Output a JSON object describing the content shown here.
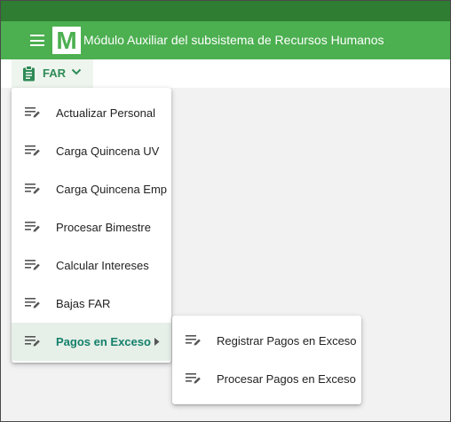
{
  "header": {
    "app_title": "Módulo Auxiliar del subsistema de Recursos Humanos",
    "logo_letter": "M",
    "menu_icon": "hamburger-icon",
    "bar_color": "#4caf50",
    "top_strip_color": "#2e7d32"
  },
  "far_menu": {
    "label": "FAR",
    "icon": "clipboard-icon",
    "chevron": "chevron-down-icon"
  },
  "dropdown": {
    "items": [
      {
        "label": "Actualizar Personal",
        "icon": "edit-list-icon"
      },
      {
        "label": "Carga Quincena UV",
        "icon": "edit-list-icon"
      },
      {
        "label": "Carga Quincena Emp",
        "icon": "edit-list-icon"
      },
      {
        "label": "Procesar Bimestre",
        "icon": "edit-list-icon"
      },
      {
        "label": "Calcular Intereses",
        "icon": "edit-list-icon"
      },
      {
        "label": "Bajas FAR",
        "icon": "edit-list-icon"
      },
      {
        "label": "Pagos en Exceso",
        "icon": "edit-list-icon",
        "active": true,
        "has_submenu": true
      }
    ]
  },
  "submenu": {
    "items": [
      {
        "label": "Registrar Pagos en Exceso",
        "icon": "edit-list-icon"
      },
      {
        "label": "Procesar Pagos en Exceso",
        "icon": "edit-list-icon"
      }
    ]
  },
  "colors": {
    "accent": "#13806a",
    "active_bg": "#e6efe8"
  }
}
